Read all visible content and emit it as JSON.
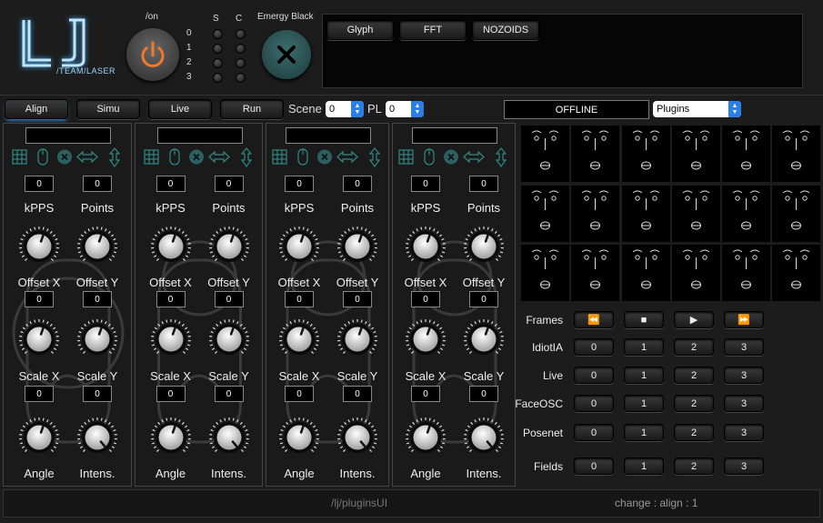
{
  "logo": {
    "letters": "LJ",
    "subtitle": "/TEAM/LASER"
  },
  "power": {
    "label": "/on"
  },
  "sc": {
    "s_label": "S",
    "c_label": "C",
    "rows": [
      "0",
      "1",
      "2",
      "3"
    ]
  },
  "emergency": {
    "label": "Emergy Black"
  },
  "top_tabs": [
    "Glyph",
    "FFT",
    "NOZOIDS"
  ],
  "mode_tabs": [
    "Align",
    "Simu",
    "Live",
    "Run"
  ],
  "scene": {
    "label": "Scene",
    "value": "0"
  },
  "pl": {
    "label": "PL",
    "value": "0"
  },
  "status": {
    "text": "OFFLINE"
  },
  "plugins_select": {
    "value": "Plugins"
  },
  "lasers": [
    {
      "name": "",
      "kpps": "0",
      "points": "0",
      "offset_x": "0",
      "offset_y": "0",
      "scale_x": "0",
      "scale_y": "0"
    },
    {
      "name": "",
      "kpps": "0",
      "points": "0",
      "offset_x": "0",
      "offset_y": "0",
      "scale_x": "0",
      "scale_y": "0"
    },
    {
      "name": "",
      "kpps": "0",
      "points": "0",
      "offset_x": "0",
      "offset_y": "0",
      "scale_x": "0",
      "scale_y": "0"
    },
    {
      "name": "",
      "kpps": "0",
      "points": "0",
      "offset_x": "0",
      "offset_y": "0",
      "scale_x": "0",
      "scale_y": "0"
    }
  ],
  "laser_labels": {
    "kpps": "kPPS",
    "points": "Points",
    "offset_x": "Offset X",
    "offset_y": "Offset Y",
    "scale_x": "Scale X",
    "scale_y": "Scale Y",
    "angle": "Angle",
    "intens": "Intens."
  },
  "controls": {
    "frames": {
      "label": "Frames",
      "buttons": [
        "⏪",
        "■",
        "▶",
        "⏩"
      ]
    },
    "rows": [
      {
        "label": "IdiotIA",
        "buttons": [
          "0",
          "1",
          "2",
          "3"
        ]
      },
      {
        "label": "Live",
        "buttons": [
          "0",
          "1",
          "2",
          "3"
        ]
      },
      {
        "label": "FaceOSC",
        "buttons": [
          "0",
          "1",
          "2",
          "3"
        ]
      },
      {
        "label": "Posenet",
        "buttons": [
          "0",
          "1",
          "2",
          "3"
        ]
      },
      {
        "label": "Fields",
        "buttons": [
          "0",
          "1",
          "2",
          "3"
        ]
      }
    ]
  },
  "footer": {
    "path": "/lj/pluginsUI",
    "status": "change : align : 1"
  }
}
